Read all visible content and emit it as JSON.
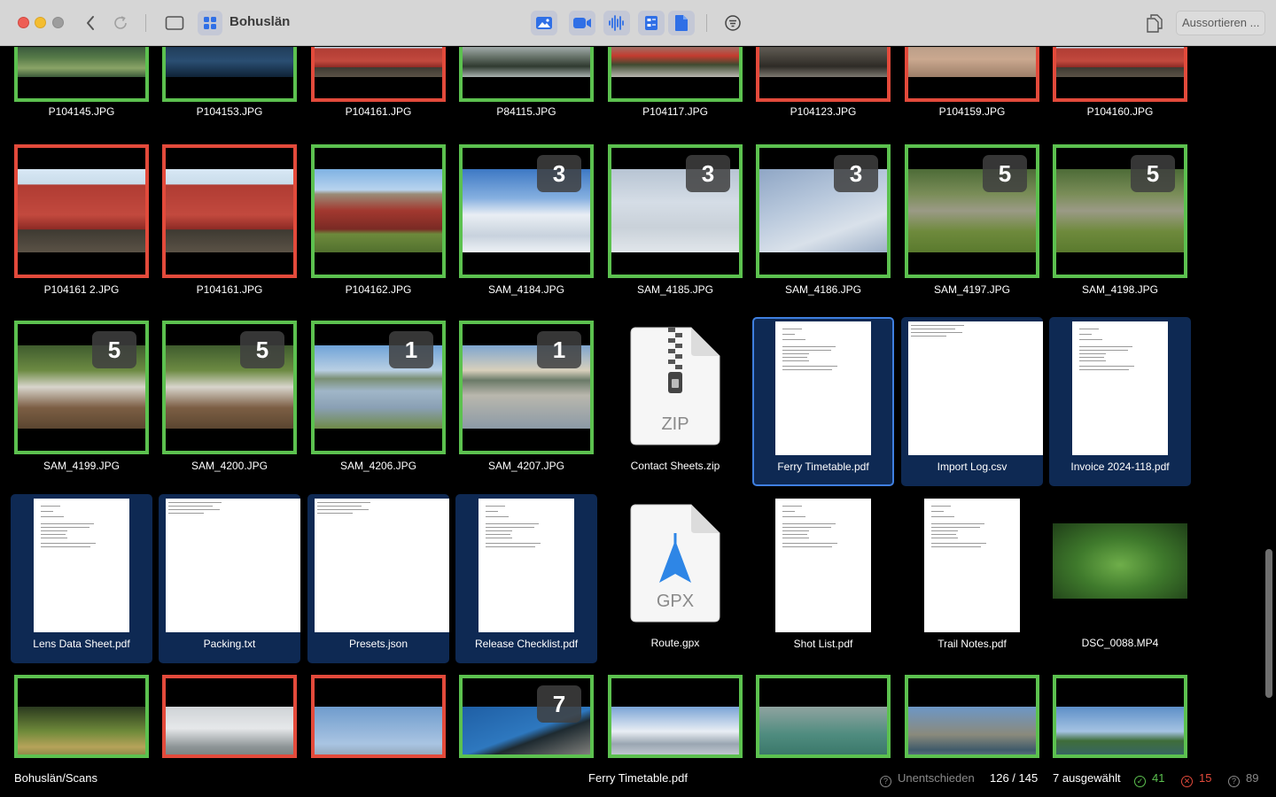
{
  "window": {
    "title": "Bohuslän",
    "sort_button_label": "Aussortieren ...",
    "filter_icons": [
      "photo-icon",
      "video-icon",
      "audio-icon",
      "contact-sheet-icon",
      "document-icon"
    ]
  },
  "colors": {
    "accepted": "#5cc14f",
    "rejected": "#e34a3b",
    "selection": "#0e2953",
    "focus_ring": "#3f7fe0"
  },
  "rows": [
    [
      {
        "name": "P104145.JPG",
        "status": "accepted",
        "kind": "photo",
        "scene": "underwater"
      },
      {
        "name": "P104153.JPG",
        "status": "accepted",
        "kind": "photo",
        "scene": "night-sea"
      },
      {
        "name": "P104161.JPG",
        "status": "rejected",
        "kind": "photo",
        "scene": "red-sheds"
      },
      {
        "name": "P84115.JPG",
        "status": "accepted",
        "kind": "photo",
        "scene": "pine-branches"
      },
      {
        "name": "P104117.JPG",
        "status": "accepted",
        "kind": "photo",
        "scene": "red-flowers"
      },
      {
        "name": "P104123.JPG",
        "status": "rejected",
        "kind": "photo",
        "scene": "rocks-dark"
      },
      {
        "name": "P104159.JPG",
        "status": "rejected",
        "kind": "photo",
        "scene": "sand-rocks"
      },
      {
        "name": "P104160.JPG",
        "status": "rejected",
        "kind": "photo",
        "scene": "red-sheds"
      }
    ],
    [
      {
        "name": "P104161 2.JPG",
        "status": "rejected",
        "kind": "photo",
        "scene": "red-sheds"
      },
      {
        "name": "P104161.JPG",
        "status": "rejected",
        "kind": "photo",
        "scene": "red-sheds"
      },
      {
        "name": "P104162.JPG",
        "status": "accepted",
        "kind": "photo",
        "scene": "red-sheds-wide"
      },
      {
        "name": "SAM_4184.JPG",
        "status": "accepted",
        "kind": "photo",
        "scene": "snow-blue",
        "badge": "3"
      },
      {
        "name": "SAM_4185.JPG",
        "status": "accepted",
        "kind": "photo",
        "scene": "snow-grey",
        "badge": "3"
      },
      {
        "name": "SAM_4186.JPG",
        "status": "accepted",
        "kind": "photo",
        "scene": "snow-slope",
        "badge": "3"
      },
      {
        "name": "SAM_4197.JPG",
        "status": "accepted",
        "kind": "photo",
        "scene": "reindeer",
        "badge": "5"
      },
      {
        "name": "SAM_4198.JPG",
        "status": "accepted",
        "kind": "photo",
        "scene": "reindeer",
        "badge": "5"
      }
    ],
    [
      {
        "name": "SAM_4199.JPG",
        "status": "accepted",
        "kind": "photo",
        "scene": "reindeer-white",
        "badge": "5"
      },
      {
        "name": "SAM_4200.JPG",
        "status": "accepted",
        "kind": "photo",
        "scene": "reindeer-white",
        "badge": "5"
      },
      {
        "name": "SAM_4206.JPG",
        "status": "accepted",
        "kind": "photo",
        "scene": "lake",
        "badge": "1"
      },
      {
        "name": "SAM_4207.JPG",
        "status": "accepted",
        "kind": "photo",
        "scene": "lake-reflection",
        "badge": "1"
      },
      {
        "name": "Contact Sheets.zip",
        "kind": "zip",
        "icon_label": "ZIP"
      },
      {
        "name": "Ferry Timetable.pdf",
        "kind": "doc",
        "selected": true,
        "focused": true,
        "doclayout": "portrait"
      },
      {
        "name": "Import Log.csv",
        "kind": "doc",
        "selected": true,
        "doclayout": "wide"
      },
      {
        "name": "Invoice 2024-118.pdf",
        "kind": "doc",
        "selected": true,
        "doclayout": "portrait"
      }
    ],
    [
      {
        "name": "Lens Data Sheet.pdf",
        "kind": "doc",
        "selected": true,
        "doclayout": "portrait"
      },
      {
        "name": "Packing.txt",
        "kind": "doc",
        "selected": true,
        "doclayout": "wide"
      },
      {
        "name": "Presets.json",
        "kind": "doc",
        "selected": true,
        "doclayout": "wide"
      },
      {
        "name": "Release Checklist.pdf",
        "kind": "doc",
        "selected": true,
        "doclayout": "portrait"
      },
      {
        "name": "Route.gpx",
        "kind": "gpx",
        "icon_label": "GPX"
      },
      {
        "name": "Shot List.pdf",
        "kind": "doc",
        "doclayout": "portrait"
      },
      {
        "name": "Trail Notes.pdf",
        "kind": "doc",
        "doclayout": "portrait"
      },
      {
        "name": "DSC_0088.MP4",
        "kind": "video",
        "scene": "ferns"
      }
    ],
    [
      {
        "name": "",
        "status": "accepted",
        "kind": "photo",
        "scene": "forest-stream"
      },
      {
        "name": "",
        "status": "rejected",
        "kind": "photo",
        "scene": "clouds-town"
      },
      {
        "name": "",
        "status": "rejected",
        "kind": "photo",
        "scene": "lighthouse"
      },
      {
        "name": "",
        "status": "accepted",
        "kind": "photo",
        "scene": "chain-boat",
        "badge": "7"
      },
      {
        "name": "",
        "status": "accepted",
        "kind": "photo",
        "scene": "snow-mountains"
      },
      {
        "name": "",
        "status": "accepted",
        "kind": "photo",
        "scene": "sea-green"
      },
      {
        "name": "",
        "status": "accepted",
        "kind": "photo",
        "scene": "harbor"
      },
      {
        "name": "",
        "status": "accepted",
        "kind": "photo",
        "scene": "bay"
      }
    ]
  ],
  "status": {
    "path": "Bohuslän/Scans",
    "current_file": "Ferry Timetable.pdf",
    "undecided_label": "Unentschieden",
    "position": "126 / 145",
    "selected_label": "7 ausgewählt",
    "accepted_count": "41",
    "rejected_count": "15",
    "undecided_count": "89"
  }
}
